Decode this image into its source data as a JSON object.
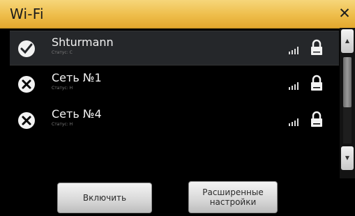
{
  "window": {
    "title": "Wi-Fi",
    "close_icon": "close-icon"
  },
  "networks": [
    {
      "name": "Shturmann",
      "status": "Статус: С",
      "icon": "wifi-connected-icon",
      "signal": "signal-icon",
      "locked": true,
      "selected": true
    },
    {
      "name": "Сеть №1",
      "status": "Статус: Н",
      "icon": "wifi-disconnected-icon",
      "signal": "signal-icon",
      "locked": true,
      "selected": false
    },
    {
      "name": "Сеть №4",
      "status": "Статус: Н",
      "icon": "wifi-disconnected-icon",
      "signal": "signal-icon",
      "locked": true,
      "selected": false
    }
  ],
  "scrollbar": {
    "up_icon": "scroll-up-icon",
    "down_icon": "scroll-down-icon"
  },
  "buttons": {
    "enable_label": "Включить",
    "advanced_label_line1": "Расширенные",
    "advanced_label_line2": "настройки"
  },
  "colors": {
    "titlebar": "#eebd4a",
    "background": "#000000",
    "selected_row": "#25272a"
  }
}
